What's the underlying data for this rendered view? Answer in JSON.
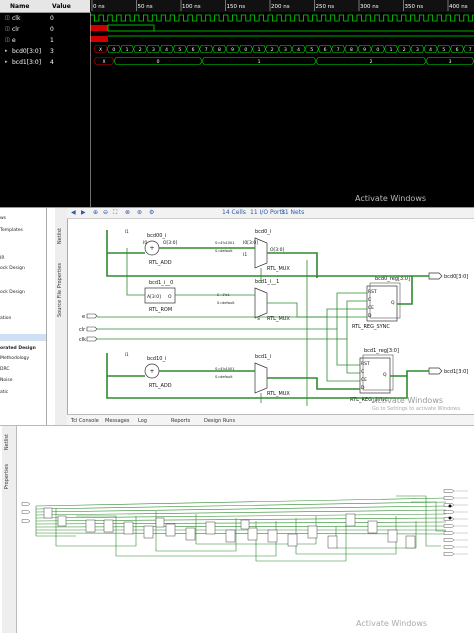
{
  "waveform": {
    "headers": {
      "name": "Name",
      "value": "Value"
    },
    "signals": [
      {
        "name": "clk",
        "value": "0"
      },
      {
        "name": "clr",
        "value": "0"
      },
      {
        "name": "e",
        "value": "1"
      },
      {
        "name": "bcd0[3:0]",
        "value": "3"
      },
      {
        "name": "bcd1[3:0]",
        "value": "4"
      }
    ],
    "time_labels": [
      "0 ns",
      "50 ns",
      "100 ns",
      "150 ns",
      "200 ns",
      "250 ns",
      "300 ns",
      "350 ns",
      "400 ns"
    ],
    "bcd0_values": [
      "X",
      "0",
      "1",
      "2",
      "3",
      "4",
      "5",
      "6",
      "7",
      "8",
      "9",
      "0",
      "1",
      "2",
      "3",
      "4",
      "5",
      "6",
      "7",
      "8",
      "9",
      "0",
      "1",
      "2",
      "3",
      "4",
      "5",
      "6",
      "7",
      "8"
    ],
    "bcd1_values": [
      "X",
      "0",
      "1",
      "2",
      "3"
    ],
    "watermark": "Activate Windows",
    "watermark_sub": "Go to Settings to activate Windows."
  },
  "schematic": {
    "side_items": [
      "ws",
      "Templates",
      "IR",
      "ock Design",
      "ock Design",
      "ation",
      "orated Design",
      "Methodology",
      "DRC",
      "Noise",
      "atic"
    ],
    "vtabs": [
      "Netlist",
      "Source File Properties"
    ],
    "toolbar": {
      "cells": "14 Cells",
      "io_ports": "11 I/O Ports",
      "nets": "31 Nets"
    },
    "bottom_tabs": [
      "Tcl Console",
      "Messages",
      "Log",
      "Reports",
      "Design Runs"
    ],
    "labels": {
      "bcd00_i": "bcd00_i",
      "rtl_add": "RTL_ADD",
      "bcd0_i": "bcd0_i",
      "rtl_mux": "RTL_MUX",
      "bcd1_i_0": "bcd1_i__0",
      "rtl_rom": "RTL_ROM",
      "bcd1_i_1": "bcd1_i__1",
      "bcd0_reg": "bcd0_reg[3:0]",
      "bcd1_reg": "bcd1_reg[3:0]",
      "rtl_reg_sync": "RTL_REG_SYNC",
      "bcd10_i": "bcd10_i",
      "bcd1_i": "bcd1_i",
      "out_bcd0": "bcd0[3:0]",
      "out_bcd1": "bcd1[3:0]",
      "in_e": "e",
      "in_clr": "clr",
      "in_clk": "clk",
      "i0": "I0[3:0]",
      "i1": "I1",
      "s": "S",
      "o": "O",
      "o30": "O[3:0]",
      "a30": "A[3:0]",
      "rst": "RST",
      "c": "C",
      "ce": "CE",
      "d": "D",
      "q": "Q",
      "sel1": "S=4'b1001",
      "seld": "S=default",
      "sel1b": "S=1'b1"
    },
    "watermark": "Activate Windows",
    "watermark_sub": "Go to Settings to activate Windows."
  },
  "netlist": {
    "vtabs": [
      "Netlist",
      "Properties"
    ],
    "watermark": "Activate Windows",
    "watermark_sub": "Go to Settings to activate Windows."
  },
  "colors": {
    "wave_green": "#00e000",
    "clr_red": "#cc0000",
    "wire_green": "#2e8b2e",
    "link_blue": "#2a5aa8"
  }
}
